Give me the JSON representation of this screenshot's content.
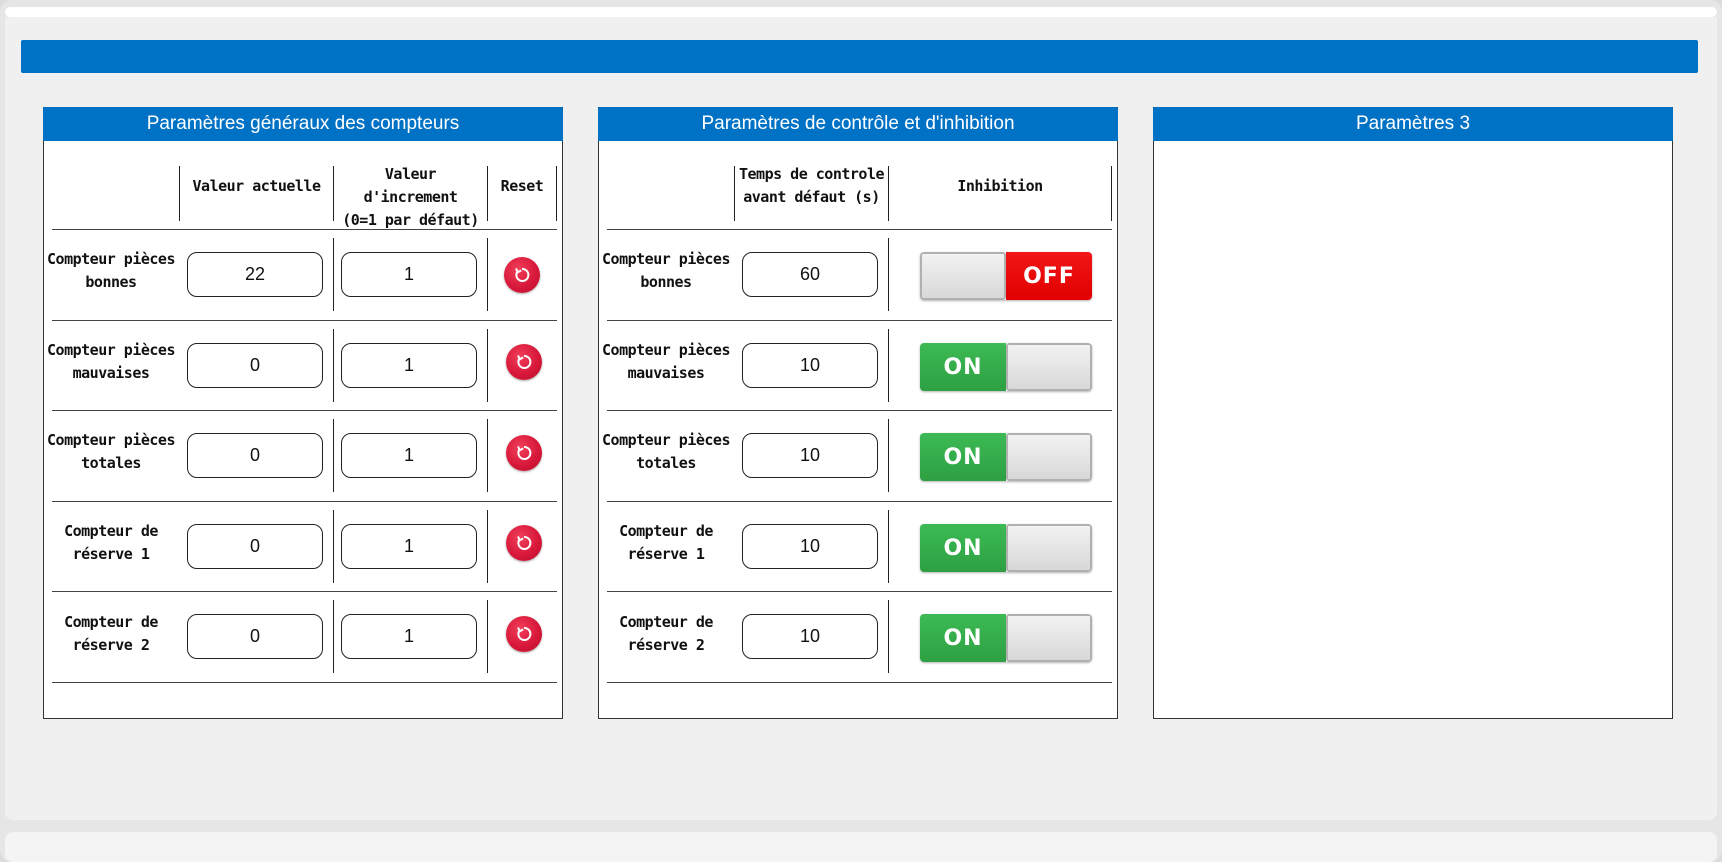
{
  "panels": {
    "counters": {
      "title": "Paramètres généraux des compteurs",
      "col_current": "Valeur actuelle",
      "col_increment_l1": "Valeur d'increment",
      "col_increment_l2": "(0=1 par défaut)",
      "col_reset": "Reset",
      "rows": [
        {
          "label_l1": "Compteur pièces",
          "label_l2": "bonnes",
          "current": "22",
          "increment": "1"
        },
        {
          "label_l1": "Compteur pièces",
          "label_l2": "mauvaises",
          "current": "0",
          "increment": "1"
        },
        {
          "label_l1": "Compteur pièces",
          "label_l2": "totales",
          "current": "0",
          "increment": "1"
        },
        {
          "label_l1": "Compteur de",
          "label_l2": "réserve 1",
          "current": "0",
          "increment": "1"
        },
        {
          "label_l1": "Compteur de",
          "label_l2": "réserve 2",
          "current": "0",
          "increment": "1"
        }
      ],
      "reset_icon": "reset-icon",
      "reset_color": "#d8183a"
    },
    "control": {
      "title": "Paramètres de contrôle et d'inhibition",
      "col_time_l1": "Temps de controle",
      "col_time_l2": "avant défaut (s)",
      "col_inhibit": "Inhibition",
      "rows": [
        {
          "label_l1": "Compteur pièces",
          "label_l2": "bonnes",
          "time": "60",
          "inhibit_state": "OFF"
        },
        {
          "label_l1": "Compteur pièces",
          "label_l2": "mauvaises",
          "time": "10",
          "inhibit_state": "ON"
        },
        {
          "label_l1": "Compteur pièces",
          "label_l2": "totales",
          "time": "10",
          "inhibit_state": "ON"
        },
        {
          "label_l1": "Compteur de",
          "label_l2": "réserve 1",
          "time": "10",
          "inhibit_state": "ON"
        },
        {
          "label_l1": "Compteur de",
          "label_l2": "réserve 2",
          "time": "10",
          "inhibit_state": "ON"
        }
      ],
      "on_color": "#2ea043",
      "off_color": "#e00000"
    },
    "params3": {
      "title": "Paramètres 3"
    }
  },
  "accent_color": "#0072c6"
}
